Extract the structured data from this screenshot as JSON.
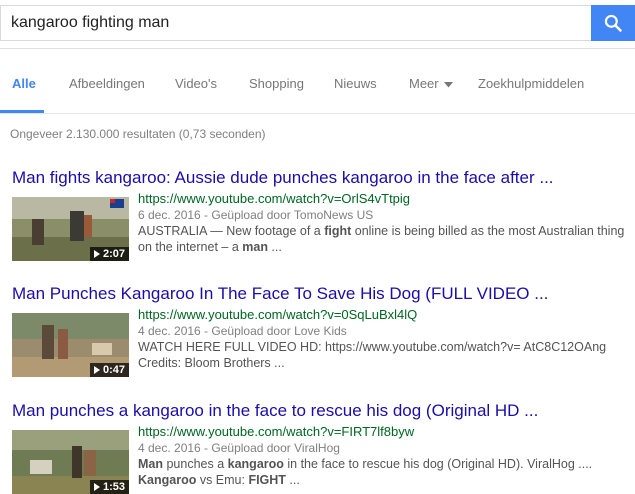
{
  "search": {
    "query": "kangaroo fighting man"
  },
  "tabs": [
    {
      "label": "Alle",
      "active": true
    },
    {
      "label": "Afbeeldingen"
    },
    {
      "label": "Video's"
    },
    {
      "label": "Shopping"
    },
    {
      "label": "Nieuws"
    },
    {
      "label": "Meer"
    },
    {
      "label": "Zoekhulpmiddelen"
    }
  ],
  "stats": "Ongeveer 2.130.000 resultaten (0,73 seconden)",
  "results": [
    {
      "title": "Man fights kangaroo: Aussie dude punches kangaroo in the face after ...",
      "url": "https://www.youtube.com/watch?v=OrlS4vTtpig",
      "meta": "6 dec. 2016 - Geüpload door TomoNews US",
      "snippet_parts": [
        "AUSTRALIA — New footage of a ",
        "fight",
        " online is being billed as the most Australian thing on the internet – a ",
        "man",
        " ..."
      ],
      "duration": "2:07"
    },
    {
      "title": "Man Punches Kangaroo In The Face To Save His Dog (FULL VIDEO ...",
      "url": "https://www.youtube.com/watch?v=0SqLuBxl4lQ",
      "meta": "4 dec. 2016 - Geüpload door Love Kids",
      "snippet_parts": [
        "WATCH HERE FULL VIDEO HD: https://www.youtube.com/watch?v= AtC8C12OAng Credits: Bloom Brothers ..."
      ],
      "duration": "0:47"
    },
    {
      "title": "Man punches a kangaroo in the face to rescue his dog (Original HD ...",
      "url": "https://www.youtube.com/watch?v=FIRT7lf8byw",
      "meta": "4 dec. 2016 - Geüpload door ViralHog",
      "snippet_parts": [
        "Man",
        " punches a ",
        "kangaroo",
        " in the face to rescue his dog (Original HD). ViralHog .... ",
        "Kangaroo",
        " vs Emu: ",
        "FIGHT",
        " ..."
      ],
      "duration": "1:53"
    }
  ],
  "colors": {
    "accent": "#4285f4",
    "link": "#1a0dab",
    "url": "#006621",
    "meta": "#808080"
  },
  "icons": {
    "search_button": "search-icon",
    "meer_dropdown": "caret-down-icon",
    "video_overlay": "play-icon"
  }
}
